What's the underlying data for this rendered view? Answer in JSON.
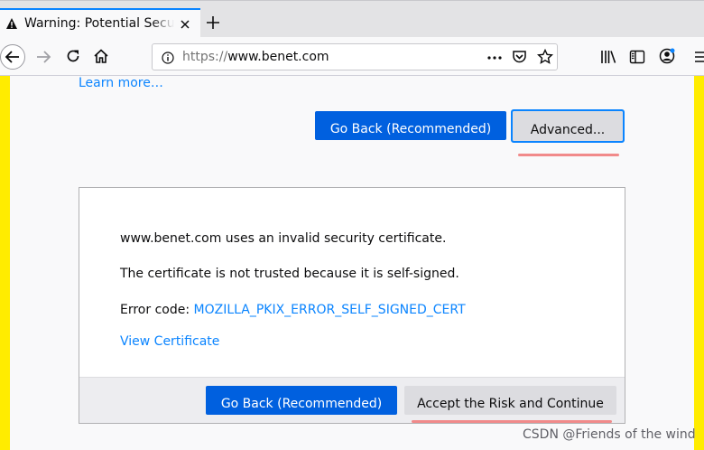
{
  "browser": {
    "tab": {
      "title": "Warning: Potential Security Risk Ahead",
      "icon": "warning-icon"
    },
    "url": {
      "scheme": "https://",
      "host": "www.benet.com"
    }
  },
  "page": {
    "learn_more": "Learn more…",
    "go_back_label": "Go Back (Recommended)",
    "advanced_label": "Advanced...",
    "advanced_panel": {
      "line1": "www.benet.com uses an invalid security certificate.",
      "line2": "The certificate is not trusted because it is self-signed.",
      "error_label": "Error code:",
      "error_code": "MOZILLA_PKIX_ERROR_SELF_SIGNED_CERT",
      "view_certificate": "View Certificate",
      "go_back_label": "Go Back (Recommended)",
      "accept_label": "Accept the Risk and Continue"
    }
  },
  "watermark": "CSDN @Friends of the wind",
  "colors": {
    "accent": "#0a84ff",
    "primary_button": "#0060df",
    "warning_stripe": "#ffec00",
    "annotation": "#f18a8a"
  }
}
